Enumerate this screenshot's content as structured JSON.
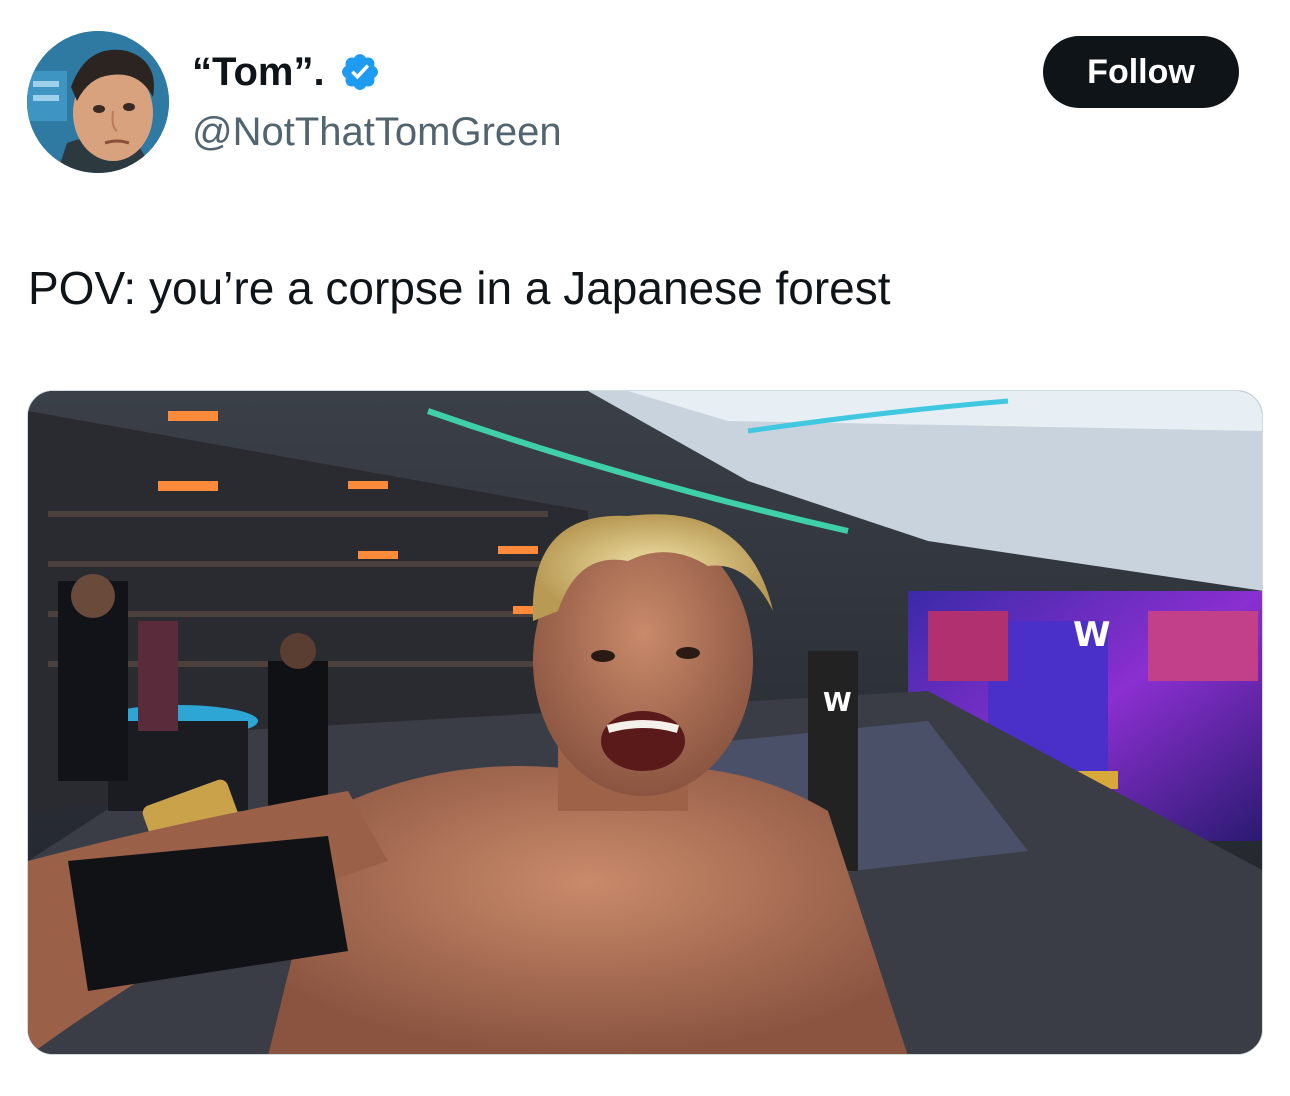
{
  "tweet": {
    "author": {
      "display_name": "“Tom”.",
      "handle": "@NotThatTomGreen",
      "verified": true,
      "verified_icon": "verified-badge-icon",
      "avatar": "profile-photo"
    },
    "follow_label": "Follow",
    "text": "POV: you’re a corpse in a Japanese forest",
    "media": {
      "type": "photo",
      "icon": "wrestling-arena-selfie-photo"
    }
  },
  "colors": {
    "text": "#0f1419",
    "secondary_text": "#536471",
    "follow_bg": "#0f1419",
    "verified": "#1d9bf0"
  }
}
